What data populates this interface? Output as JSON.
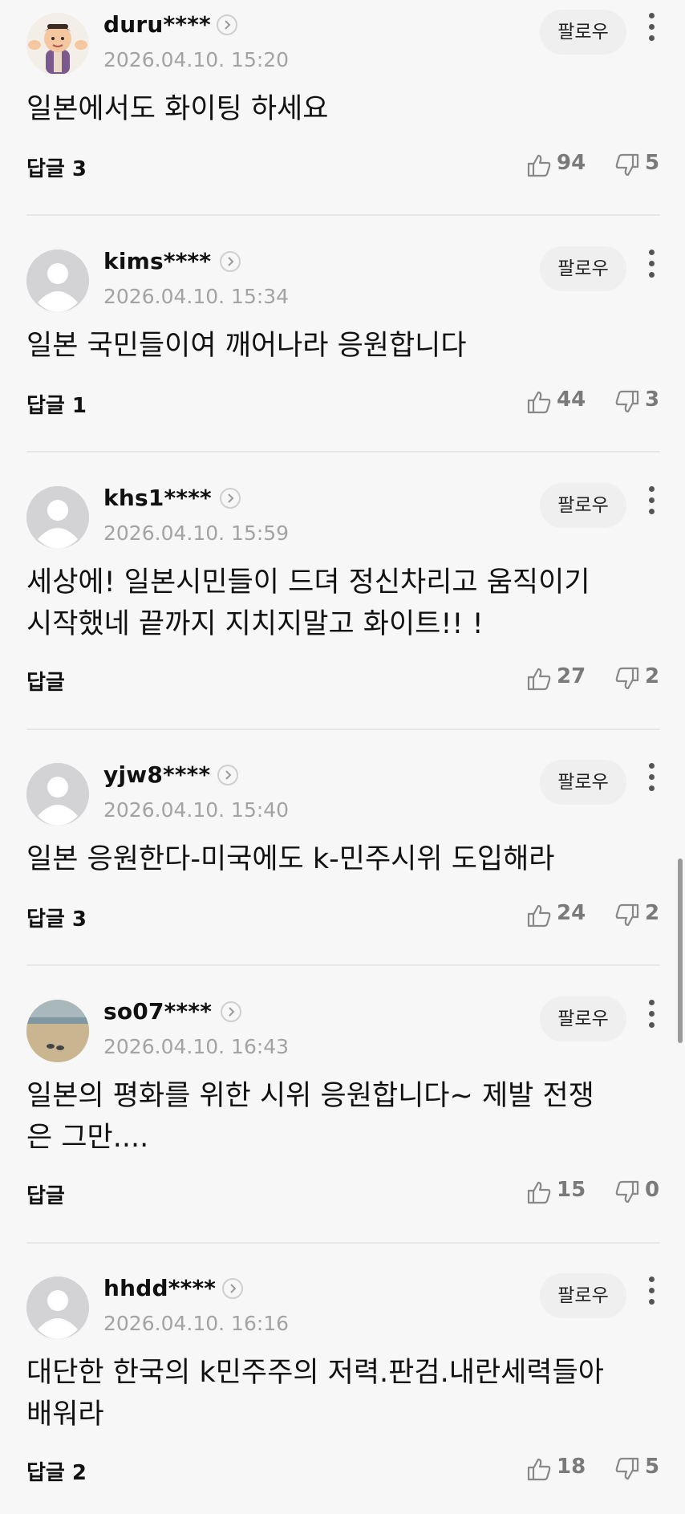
{
  "comments": [
    {
      "username": "duru****",
      "timestamp": "2026.04.10. 15:20",
      "follow_label": "팔로우",
      "text": "일본에서도 화이팅 하세요",
      "reply_label": "답글 3",
      "likes": "94",
      "dislikes": "5",
      "avatar": "cartoon-character"
    },
    {
      "username": "kims****",
      "timestamp": "2026.04.10. 15:34",
      "follow_label": "팔로우",
      "text": "일본 국민들이여 깨어나라 응원합니다",
      "reply_label": "답글 1",
      "likes": "44",
      "dislikes": "3",
      "avatar": "default"
    },
    {
      "username": "khs1****",
      "timestamp": "2026.04.10. 15:59",
      "follow_label": "팔로우",
      "text": "세상에! 일본시민들이 드뎌 정신차리고 움직이기\n시작했네 끝까지 지치지말고 화이트!! !",
      "reply_label": "답글",
      "likes": "27",
      "dislikes": "2",
      "avatar": "default"
    },
    {
      "username": "yjw8****",
      "timestamp": "2026.04.10. 15:40",
      "follow_label": "팔로우",
      "text": "일본 응원한다-미국에도 k-민주시위 도입해라",
      "reply_label": "답글 3",
      "likes": "24",
      "dislikes": "2",
      "avatar": "default"
    },
    {
      "username": "so07****",
      "timestamp": "2026.04.10. 16:43",
      "follow_label": "팔로우",
      "text": "일본의 평화를 위한 시위 응원합니다~ 제발 전쟁\n은 그만....",
      "reply_label": "답글",
      "likes": "15",
      "dislikes": "0",
      "avatar": "beach-photo"
    },
    {
      "username": "hhdd****",
      "timestamp": "2026.04.10. 16:16",
      "follow_label": "팔로우",
      "text": "대단한 한국의 k민주주의 저력.판검.내란세력들아\n배워라",
      "reply_label": "답글 2",
      "likes": "18",
      "dislikes": "5",
      "avatar": "default"
    }
  ],
  "colors": {
    "background": "#f7f7f7",
    "follow_button_bg": "#efefef",
    "muted_text": "#a3a3a3",
    "count_text": "#7a7a7a",
    "divider": "#e6e6e6"
  }
}
